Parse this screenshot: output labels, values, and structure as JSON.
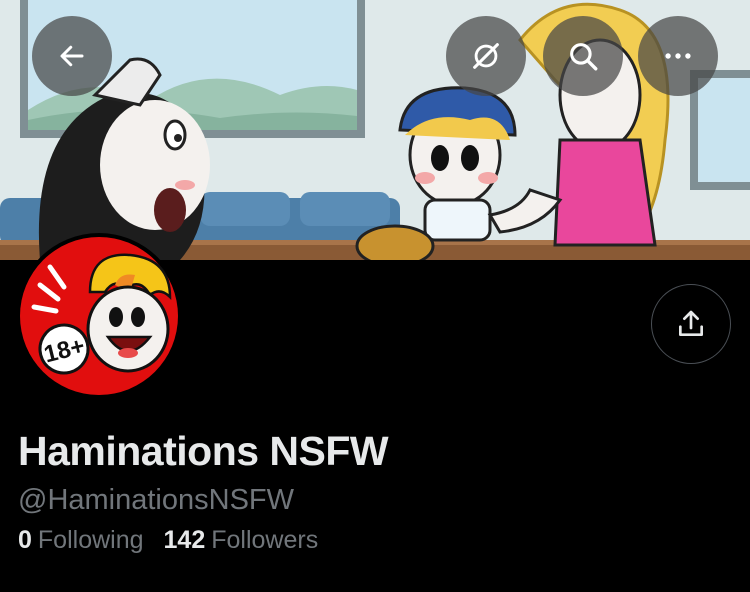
{
  "profile": {
    "display_name": "Haminations NSFW",
    "handle": "@HaminationsNSFW",
    "avatar_badge": "18+"
  },
  "stats": {
    "following_count": "0",
    "following_label": "Following",
    "followers_count": "142",
    "followers_label": "Followers"
  },
  "top_bar": {
    "back_icon": "arrow-left-icon",
    "grok_icon": "grok-icon",
    "search_icon": "search-icon",
    "more_icon": "more-horizontal-icon"
  },
  "actions": {
    "share_icon": "share-icon"
  },
  "colors": {
    "background": "#000000",
    "text_primary": "#e7e9ea",
    "text_secondary": "#71767b",
    "avatar_red": "#e10e0e"
  }
}
